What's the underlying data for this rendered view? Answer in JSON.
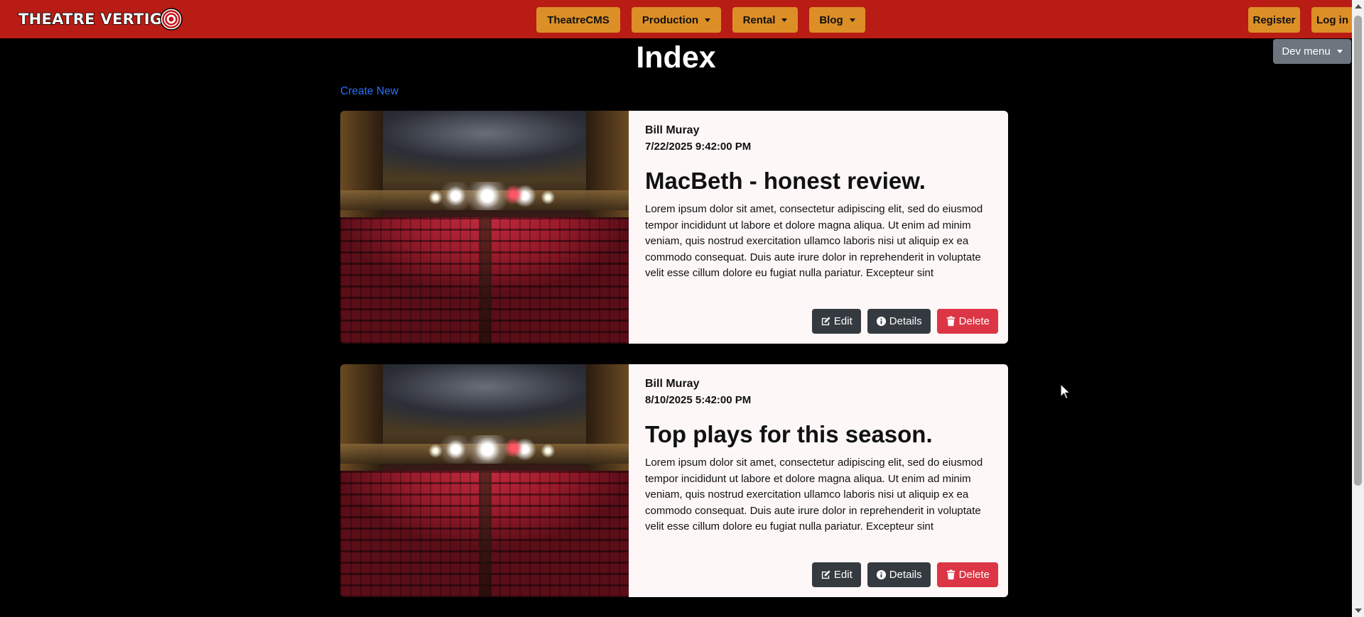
{
  "navbar": {
    "logo_text": "THEATRE VERTIGO",
    "logo_main": "THEATRE VERTIG",
    "logo_o": "O",
    "center_items": [
      {
        "label": "TheatreCMS",
        "dropdown": false
      },
      {
        "label": "Production",
        "dropdown": true
      },
      {
        "label": "Rental",
        "dropdown": true
      },
      {
        "label": "Blog",
        "dropdown": true
      }
    ],
    "register_label": "Register",
    "login_label": "Log in",
    "dev_menu_label": "Dev menu"
  },
  "page": {
    "title": "Index",
    "create_new_label": "Create New"
  },
  "posts": [
    {
      "author": "Bill Muray",
      "date": "7/22/2025 9:42:00 PM",
      "title": "MacBeth - honest review.",
      "excerpt": "Lorem ipsum dolor sit amet, consectetur adipiscing elit, sed do eiusmod tempor incididunt ut labore et dolore magna aliqua. Ut enim ad minim veniam, quis nostrud exercitation ullamco laboris nisi ut aliquip ex ea commodo consequat. Duis aute irure dolor in reprehenderit in voluptate velit esse cillum dolore eu fugiat nulla pariatur. Excepteur sint occaecat...",
      "edit_label": "Edit",
      "details_label": "Details",
      "delete_label": "Delete"
    },
    {
      "author": "Bill Muray",
      "date": "8/10/2025 5:42:00 PM",
      "title": "Top plays for this season.",
      "excerpt": "Lorem ipsum dolor sit amet, consectetur adipiscing elit, sed do eiusmod tempor incididunt ut labore et dolore magna aliqua. Ut enim ad minim veniam, quis nostrud exercitation ullamco laboris nisi ut aliquip ex ea commodo consequat. Duis aute irure dolor in reprehenderit in voluptate velit esse cillum dolore eu fugiat nulla pariatur. Excepteur sint occaecat...",
      "edit_label": "Edit",
      "details_label": "Details",
      "delete_label": "Delete"
    }
  ],
  "colors": {
    "navbar": "#b81c14",
    "nav_button": "#dc8f26",
    "card_body": "#fdf8f7",
    "btn_dark": "#343a40",
    "btn_danger": "#dc3545",
    "link": "#2a6ef5",
    "dev_menu": "#6c757d"
  }
}
